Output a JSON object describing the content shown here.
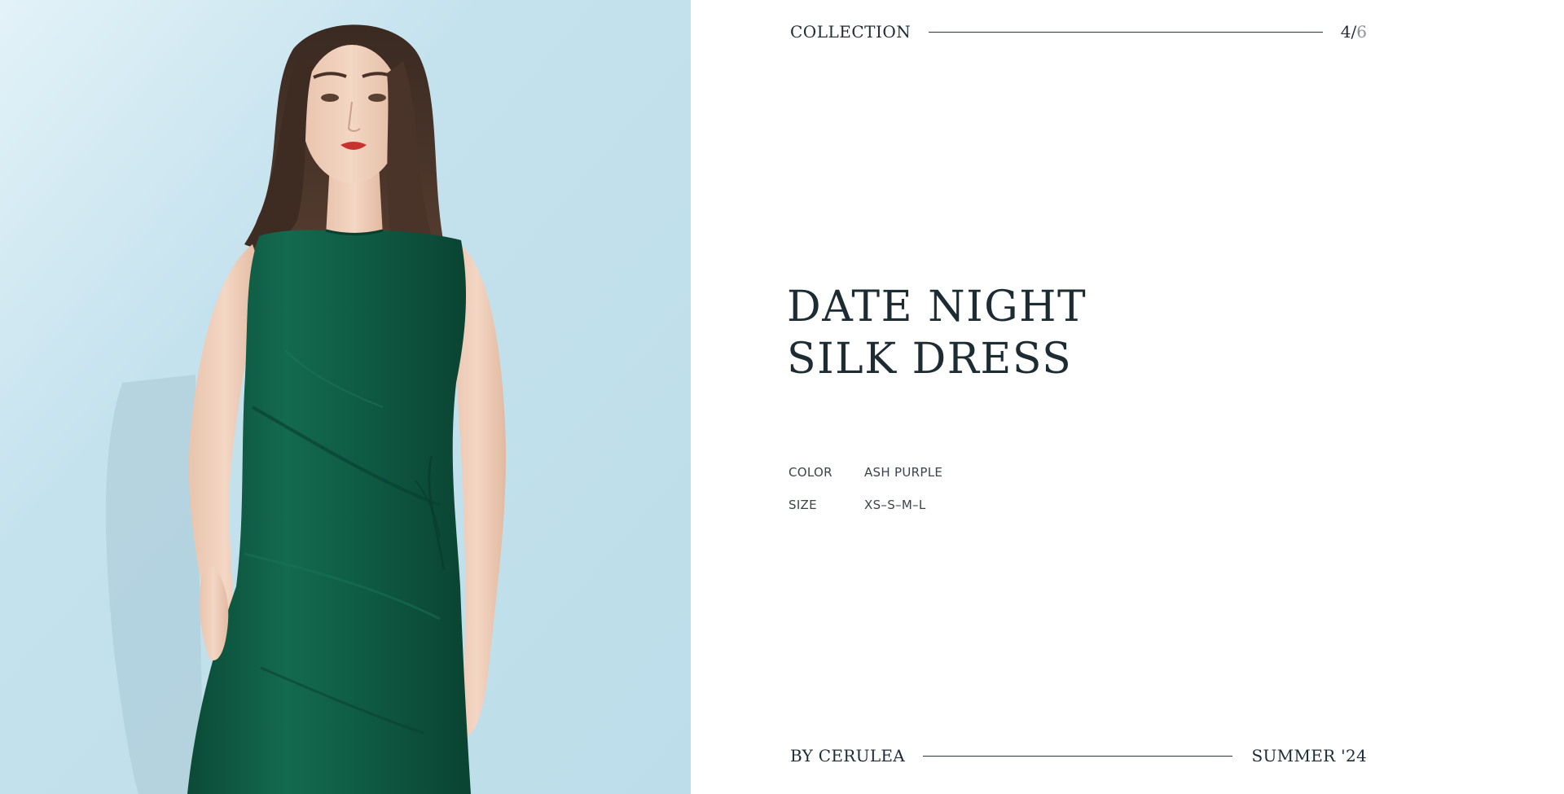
{
  "header": {
    "collection_label": "COLLECTION",
    "page_current": "4",
    "page_separator": "/",
    "page_total": "6"
  },
  "product": {
    "title_line1": "DATE NIGHT",
    "title_line2": "SILK DRESS",
    "specs": [
      {
        "key": "COLOR",
        "value": "ASH PURPLE"
      },
      {
        "key": "SIZE",
        "value": "XS–S–M–L"
      }
    ]
  },
  "footer": {
    "brand": "BY CERULEA",
    "season": "SUMMER '24"
  },
  "colors": {
    "background": "#ffffff",
    "photo_background": "#bfdfeb",
    "dress": "#0f5a43",
    "text": "#1d2b33",
    "muted": "#8a9196"
  },
  "icons": []
}
